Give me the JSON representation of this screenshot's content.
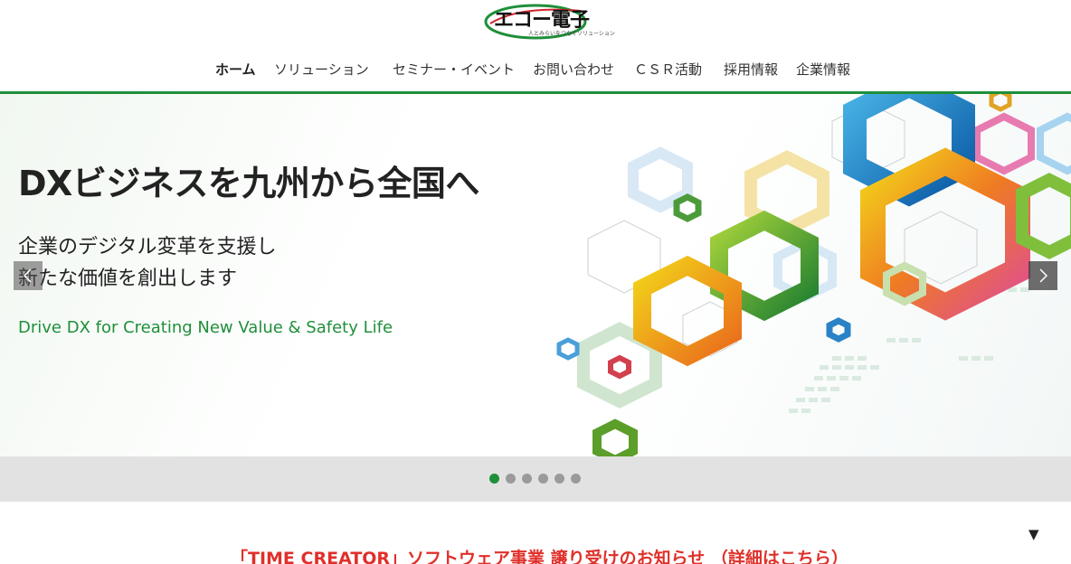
{
  "header": {
    "logo_text": "エコー電子",
    "logo_sub": "人とみらいをつなぐソリューション"
  },
  "nav": [
    {
      "label": "ホーム",
      "active": true
    },
    {
      "label": "ソリューション",
      "active": false
    },
    {
      "label": "セミナー・イベント",
      "active": false
    },
    {
      "label": "お問い合わせ",
      "active": false
    },
    {
      "label": "ＣＳＲ活動",
      "active": false
    },
    {
      "label": "採用情報",
      "active": false
    },
    {
      "label": "企業情報",
      "active": false
    }
  ],
  "hero": {
    "title": "DXビジネスを九州から全国へ",
    "line1": "企業のデジタル変革を支援し",
    "line2": "新たな価値を創出します",
    "subtitle": "Drive DX for Creating New Value & Safety Life"
  },
  "pager": {
    "count": 6,
    "active_index": 0
  },
  "notice": {
    "text": "「TIME CREATOR」ソフトウェア事業 譲り受けのお知らせ （詳細はこちら）",
    "toggle_arrow": "▼"
  },
  "colors": {
    "brand_green": "#1f8f3a",
    "notice_red": "#e0302a",
    "logo_red": "#d0252b"
  }
}
